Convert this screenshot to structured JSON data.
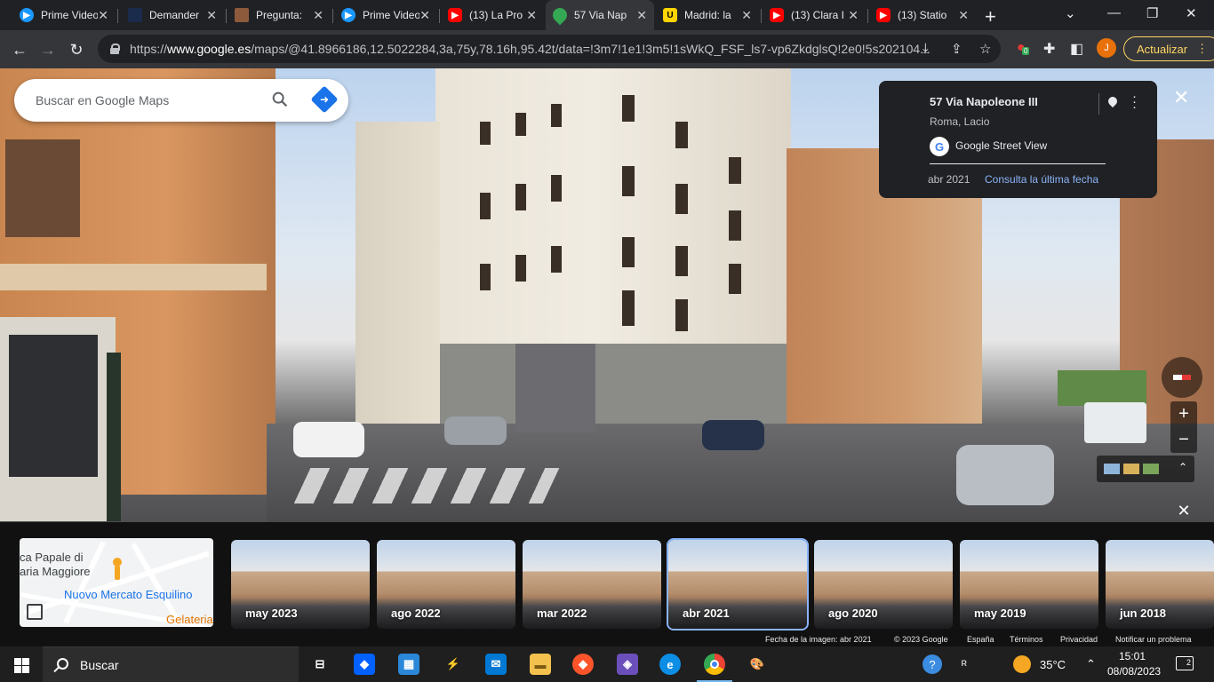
{
  "browser": {
    "tabs": [
      {
        "label": "Prime Video",
        "icon": "prime-video-icon",
        "color": "#1a98ff"
      },
      {
        "label": "Demander",
        "icon": "demander-icon",
        "color": "#1b2b4b"
      },
      {
        "label": "Pregunta:",
        "icon": "pregunta-icon",
        "color": "#8d5a3b"
      },
      {
        "label": "Prime Video",
        "icon": "prime-video-icon",
        "color": "#1a98ff"
      },
      {
        "label": "(13) La Pro",
        "icon": "youtube-icon",
        "color": "#ff0000"
      },
      {
        "label": "57 Via Nap",
        "icon": "google-maps-icon",
        "color": "#34a853"
      },
      {
        "label": "Madrid: la",
        "icon": "u-icon",
        "color": "#ffd400"
      },
      {
        "label": "(13) Clara I",
        "icon": "youtube-icon",
        "color": "#ff0000"
      },
      {
        "label": "(13) Statio",
        "icon": "youtube-icon",
        "color": "#ff0000"
      }
    ],
    "url_prefix": "https://",
    "url_host": "www.google.es",
    "url_rest": "/maps/@41.8966186,12.5022284,3a,75y,78.16h,95.42t/data=!3m7!1e1!3m5!1sWkQ_FSF_ls7-vp6ZkdglsQ!2e0!5s202104...",
    "profile_initial": "J",
    "update_label": "Actualizar",
    "extension_badge": "0"
  },
  "maps": {
    "search_placeholder": "Buscar en Google Maps",
    "info": {
      "address": "57 Via Napoleone III",
      "city": "Roma, Lacio",
      "source": "Google Street View",
      "date": "abr 2021",
      "latest_link": "Consulta la última fecha"
    },
    "minimap": {
      "line1": "ca Papale di",
      "line2": "aria Maggiore",
      "line3": "Nuovo Mercato Esquilino",
      "line4": "Gelateria"
    },
    "timeline": [
      "may 2023",
      "ago 2022",
      "mar 2022",
      "abr 2021",
      "ago 2020",
      "may 2019",
      "jun 2018"
    ],
    "selected_timeline": "abr 2021",
    "footer": {
      "image_date": "Fecha de la imagen: abr 2021",
      "copyright": "© 2023 Google",
      "country": "España",
      "terms": "Términos",
      "privacy": "Privacidad",
      "report": "Notificar un problema"
    }
  },
  "taskbar": {
    "search_label": "Buscar",
    "weather": "35°C",
    "time": "15:01",
    "date": "08/08/2023",
    "notifications": "2"
  },
  "colors": {
    "accent": "#1a73e8",
    "link": "#8ab4f8",
    "update": "#fdd663"
  }
}
